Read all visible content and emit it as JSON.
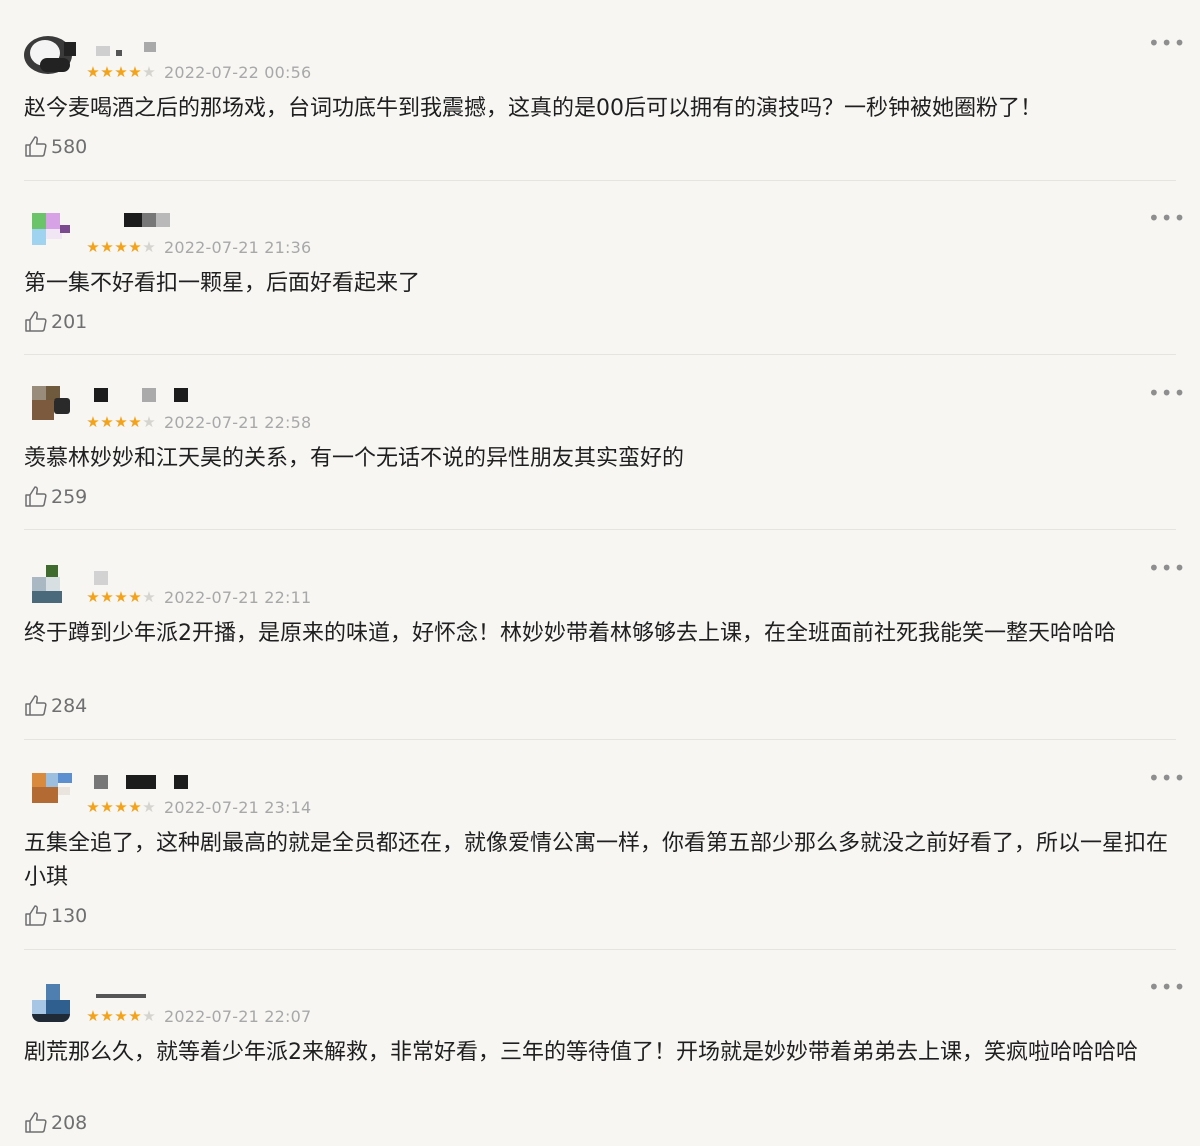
{
  "reviews": [
    {
      "stars": 4,
      "date": "2022-07-22 00:56",
      "text": "赵今麦喝酒之后的那场戏，台词功底牛到我震撼，这真的是00后可以拥有的演技吗？一秒钟被她圈粉了！",
      "likes": "580"
    },
    {
      "stars": 4,
      "date": "2022-07-21 21:36",
      "text": "第一集不好看扣一颗星，后面好看起来了",
      "likes": "201"
    },
    {
      "stars": 4,
      "date": "2022-07-21 22:58",
      "text": "羡慕林妙妙和江天昊的关系，有一个无话不说的异性朋友其实蛮好的",
      "likes": "259"
    },
    {
      "stars": 4,
      "date": "2022-07-21 22:11",
      "text": "终于蹲到少年派2开播，是原来的味道，好怀念！林妙妙带着林够够去上课，在全班面前社死我能笑一整天哈哈哈",
      "likes": "284"
    },
    {
      "stars": 4,
      "date": "2022-07-21 23:14",
      "text": "五集全追了，这种剧最高的就是全员都还在，就像爱情公寓一样，你看第五部少那么多就没之前好看了，所以一星扣在小琪",
      "likes": "130"
    },
    {
      "stars": 4,
      "date": "2022-07-21 22:07",
      "text": "剧荒那么久，就等着少年派2来解救，非常好看，三年的等待值了！开场就是妙妙带着弟弟去上课，笑疯啦哈哈哈哈",
      "likes": "208"
    }
  ],
  "icons": {
    "like": "thumbs-up-icon",
    "more": "more-dots-icon",
    "star_on": "#f3a31b",
    "star_off": "#d6d4cf"
  }
}
